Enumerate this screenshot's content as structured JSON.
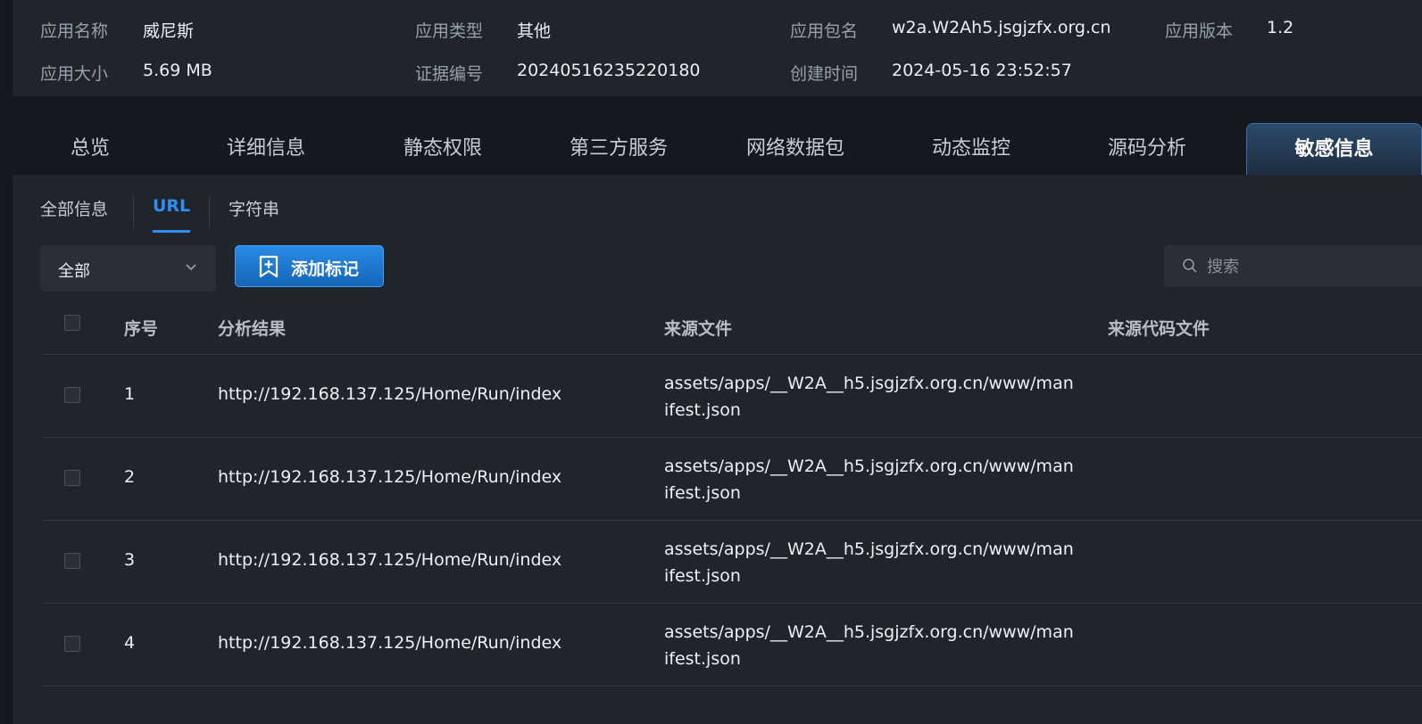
{
  "app_info": {
    "name_label": "应用名称",
    "name_value": "威尼斯",
    "type_label": "应用类型",
    "type_value": "其他",
    "package_label": "应用包名",
    "package_value": "w2a.W2Ah5.jsgjzfx.org.cn",
    "version_label": "应用版本",
    "version_value": "1.2",
    "size_label": "应用大小",
    "size_value": "5.69 MB",
    "evidence_label": "证据编号",
    "evidence_value": "20240516235220180",
    "created_label": "创建时间",
    "created_value": "2024-05-16 23:52:57"
  },
  "tabs": [
    {
      "label": "总览"
    },
    {
      "label": "详细信息"
    },
    {
      "label": "静态权限"
    },
    {
      "label": "第三方服务"
    },
    {
      "label": "网络数据包"
    },
    {
      "label": "动态监控"
    },
    {
      "label": "源码分析"
    },
    {
      "label": "敏感信息",
      "active": true
    }
  ],
  "subtabs": [
    {
      "label": "全部信息"
    },
    {
      "label": "URL",
      "active": true
    },
    {
      "label": "字符串"
    }
  ],
  "toolbar": {
    "filter_value": "全部",
    "add_mark_label": "添加标记",
    "search_placeholder": "搜索"
  },
  "table": {
    "headers": {
      "index": "序号",
      "result": "分析结果",
      "source_file": "来源文件",
      "source_code_file": "来源代码文件"
    },
    "rows": [
      {
        "index": "1",
        "result": "http://192.168.137.125/Home/Run/index",
        "source_file": "assets/apps/__W2A__h5.jsgjzfx.org.cn/www/manifest.json",
        "source_code_file": ""
      },
      {
        "index": "2",
        "result": "http://192.168.137.125/Home/Run/index",
        "source_file": "assets/apps/__W2A__h5.jsgjzfx.org.cn/www/manifest.json",
        "source_code_file": ""
      },
      {
        "index": "3",
        "result": "http://192.168.137.125/Home/Run/index",
        "source_file": "assets/apps/__W2A__h5.jsgjzfx.org.cn/www/manifest.json",
        "source_code_file": ""
      },
      {
        "index": "4",
        "result": "http://192.168.137.125/Home/Run/index",
        "source_file": "assets/apps/__W2A__h5.jsgjzfx.org.cn/www/manifest.json",
        "source_code_file": ""
      }
    ]
  },
  "colors": {
    "accent": "#2e8ff0",
    "panel": "#20242c",
    "background": "#15181e"
  }
}
